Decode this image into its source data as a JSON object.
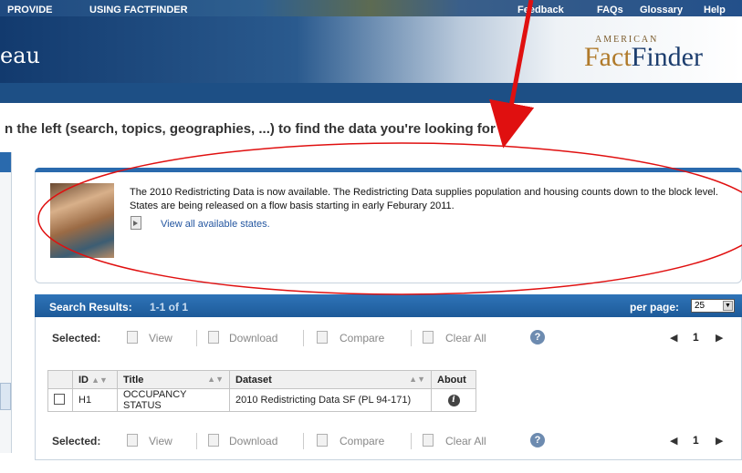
{
  "header": {
    "agency_fragment": "eau",
    "logo_small": "AMERICAN",
    "logo_part1": "Fact",
    "logo_part2": "Finder"
  },
  "nav": {
    "left_items": [
      "PROVIDE",
      "USING FACTFINDER"
    ],
    "right_items": [
      "Feedback",
      "FAQs",
      "Glossary",
      "Help"
    ]
  },
  "instructions": "n the left (search, topics, geographies, ...) to find the data you're looking for",
  "notice": {
    "text": "The 2010 Redistricting Data is now available. The Redistricting Data supplies population and housing counts down to the block level. States are being released on a flow basis starting in early Feburary 2011.",
    "link": "View all available states."
  },
  "results": {
    "title": "Search Results:",
    "count": "1-1  of  1",
    "per_page_label": "per page:",
    "per_page_value": "25",
    "toolbar": {
      "selected_label": "Selected:",
      "view": "View",
      "download": "Download",
      "compare": "Compare",
      "clear_all": "Clear All",
      "page": "1"
    },
    "columns": [
      "ID",
      "Title",
      "Dataset",
      "About"
    ],
    "rows": [
      {
        "id": "H1",
        "title": "OCCUPANCY STATUS",
        "dataset": "2010 Redistricting Data SF (PL 94-171)"
      }
    ]
  },
  "colors": {
    "nav_bar": "#1d4f85",
    "results_bar": "#2a6aad",
    "annotation_red": "#e01010",
    "link_blue": "#2456a0"
  }
}
